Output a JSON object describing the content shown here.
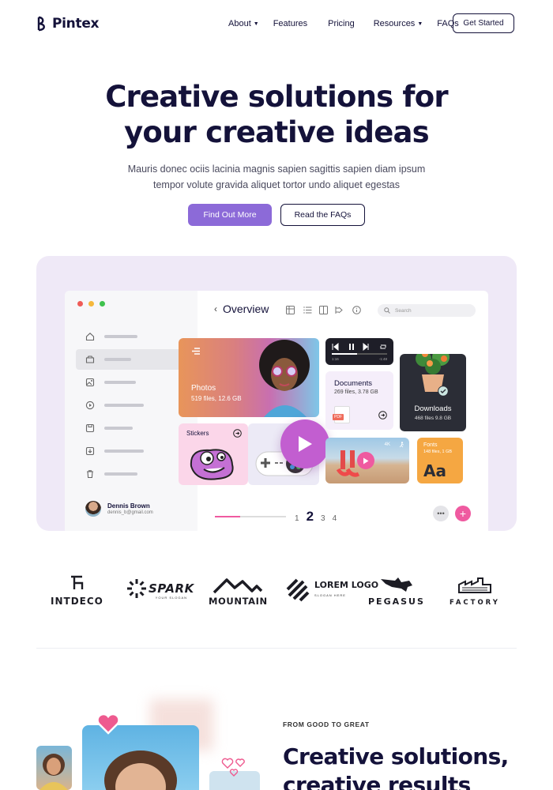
{
  "brand": {
    "name": "Pintex"
  },
  "nav": {
    "items": [
      {
        "label": "About",
        "dropdown": true
      },
      {
        "label": "Features",
        "dropdown": false
      },
      {
        "label": "Pricing",
        "dropdown": false
      },
      {
        "label": "Resources",
        "dropdown": true
      },
      {
        "label": "FAQs",
        "dropdown": false
      }
    ],
    "cta": "Get Started"
  },
  "hero": {
    "title_line1": "Creative solutions for",
    "title_line2": "your creative ideas",
    "subtitle_line1": "Mauris donec ociis lacinia magnis sapien sagittis sapien diam ipsum",
    "subtitle_line2": "tempor volute gravida aliquet tortor undo aliquet egestas",
    "primary_button": "Find Out More",
    "secondary_button": "Read the FAQs",
    "accent_color": "#8c6ad8"
  },
  "app": {
    "title": "Overview",
    "search_placeholder": "Search",
    "sidebar_icons": [
      "home-icon",
      "folder-icon",
      "image-icon",
      "play-circle-icon",
      "save-icon",
      "download-box-icon",
      "trash-icon"
    ],
    "active_sidebar_index": 1,
    "user": {
      "name": "Dennis Brown",
      "email": "dennis_b@gmail.com"
    },
    "cards": {
      "photos": {
        "label": "Photos",
        "meta": "519 files, 12.6 GB"
      },
      "stickers": {
        "label": "Stickers"
      },
      "player": {
        "elapsed": "1:16",
        "remaining": "-1:48"
      },
      "documents": {
        "label": "Documents",
        "meta": "269 files, 3.78 GB",
        "file_type": "PDF"
      },
      "downloads": {
        "label": "Downloads",
        "meta": "468 files 9.8 GB"
      },
      "video": {
        "badge": "4K"
      },
      "fonts": {
        "label": "Fonts",
        "meta": "148 files, 1 GB",
        "sample": "Aa"
      }
    },
    "progress": 0.35,
    "pagination": {
      "pages": [
        "1",
        "2",
        "3",
        "4"
      ],
      "current": "2"
    }
  },
  "logos": [
    "INTDECO",
    "SPARK",
    "MOUNTAIN",
    "LOREM LOGO",
    "PEGASUS",
    "FACTORY"
  ],
  "logo_taglines": {
    "spark": "YOUR SLOGAN",
    "lorem": "SLOGAN HERE"
  },
  "section2": {
    "kicker": "FROM GOOD TO GREAT",
    "title_line1": "Creative solutions,",
    "title_line2": "creative results"
  }
}
